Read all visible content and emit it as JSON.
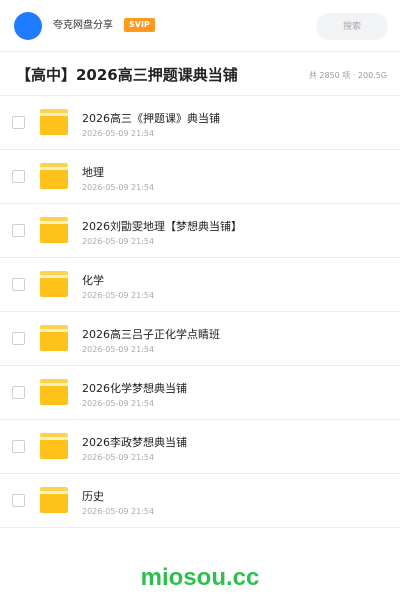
{
  "header": {
    "app_name": "夸克网盘分享",
    "badge": "SVIP",
    "search_placeholder": "搜索"
  },
  "share": {
    "title": "【高中】2026高三押题课典当铺",
    "meta": "共 2850 项 · 200.5G"
  },
  "files": [
    {
      "name": "2026高三《押题课》典当铺",
      "date": "2026-05-09 21:54"
    },
    {
      "name": "地理",
      "date": "2026-05-09 21:54"
    },
    {
      "name": "2026刘勖雯地理【梦想典当铺】",
      "date": "2026-05-09 21:54"
    },
    {
      "name": "化学",
      "date": "2026-05-09 21:54"
    },
    {
      "name": "2026高三吕子正化学点睛班",
      "date": "2026-05-09 21:54"
    },
    {
      "name": "2026化学梦想典当铺",
      "date": "2026-05-09 21:54"
    },
    {
      "name": "2026李政梦想典当铺",
      "date": "2026-05-09 21:54"
    },
    {
      "name": "历史",
      "date": "2026-05-09 21:54"
    }
  ],
  "watermark": "miosou.cc",
  "colors": {
    "avatar": "#1f7bff",
    "badge": "#ff9a1f",
    "folder": "#ffc21a",
    "watermark": "#2fbf4f"
  }
}
